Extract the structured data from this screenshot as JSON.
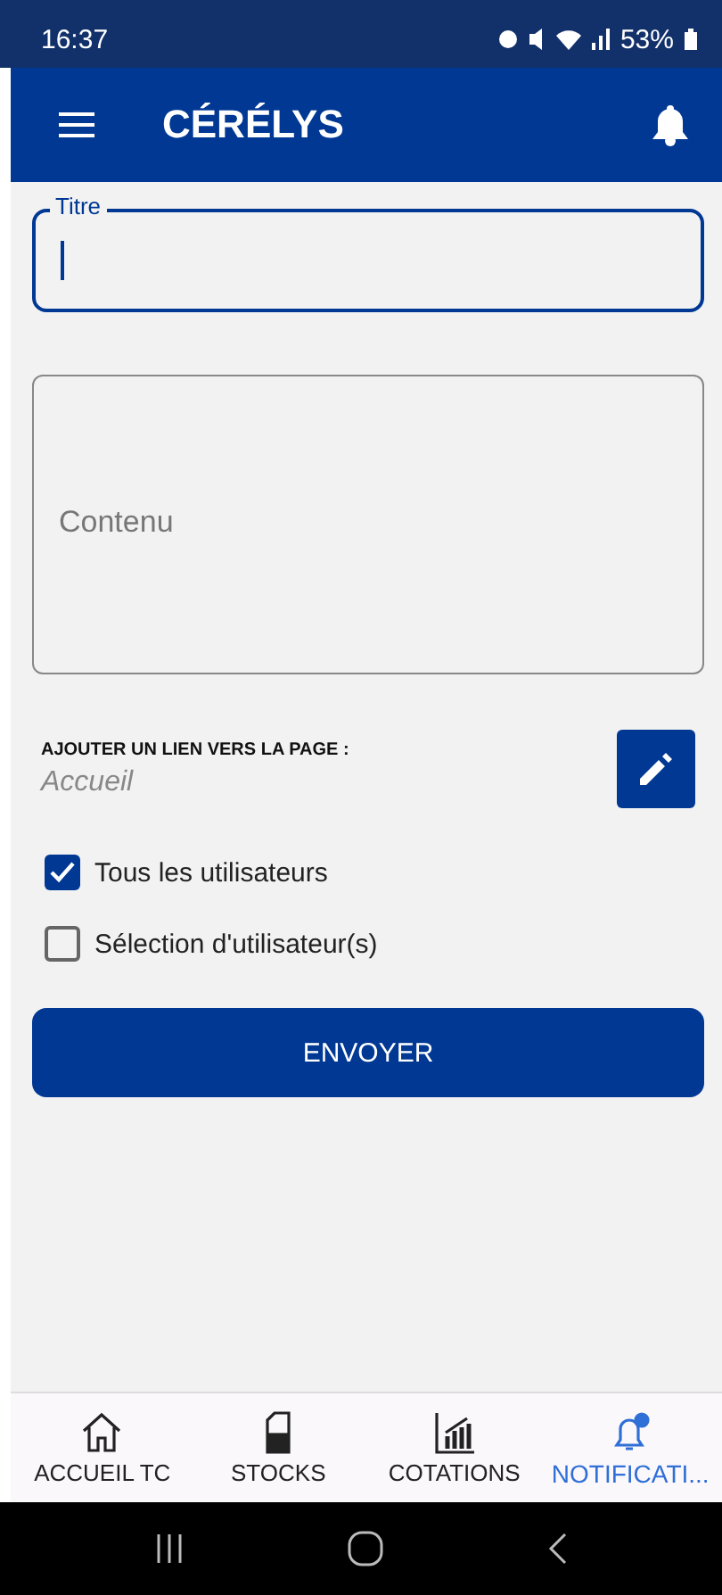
{
  "status_bar": {
    "time": "16:37",
    "battery": "53%"
  },
  "app_bar": {
    "title": "CÉRÉLYS"
  },
  "form": {
    "title_field": {
      "label": "Titre",
      "focused": true
    },
    "content_field": {
      "placeholder": "Contenu"
    },
    "link": {
      "label": "AJOUTER UN LIEN VERS LA PAGE :",
      "value": "Accueil"
    },
    "recipients": [
      {
        "label": "Tous les utilisateurs",
        "checked": true
      },
      {
        "label": "Sélection d'utilisateur(s)",
        "checked": false
      }
    ],
    "submit": "ENVOYER"
  },
  "bottom_nav": [
    {
      "label": "ACCUEIL TC",
      "kind": "home",
      "selected": false
    },
    {
      "label": "STOCKS",
      "kind": "canister",
      "selected": false
    },
    {
      "label": "COTATIONS",
      "kind": "chart",
      "selected": false
    },
    {
      "label": "NOTIFICATI...",
      "kind": "bell",
      "selected": true
    }
  ]
}
